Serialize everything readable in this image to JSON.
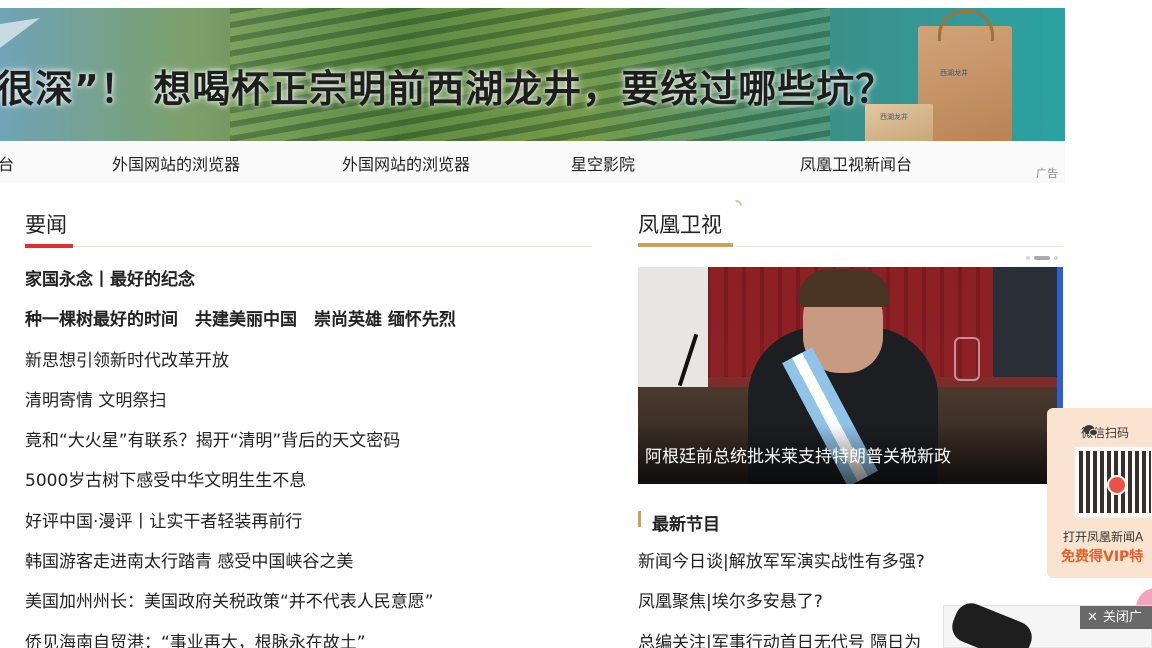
{
  "banner": {
    "headline": "很深”！ 想喝杯正宗明前西湖龙井，要绕过哪些坑？",
    "bag_text": "西湖龙井",
    "box_text": "西湖龙井"
  },
  "nav": {
    "items": [
      "台",
      "外国网站的浏览器",
      "外国网站的浏览器",
      "星空影院",
      "凤凰卫视新闻台"
    ],
    "ad_label": "广告"
  },
  "news": {
    "title": "要闻",
    "items": [
      "家国永念丨最好的纪念",
      "种一棵树最好的时间　共建美丽中国　崇尚英雄 缅怀先烈",
      "新思想引领新时代改革开放",
      "清明寄情 文明祭扫",
      "竟和“大火星”有联系？揭开“清明”背后的天文密码",
      "5000岁古树下感受中华文明生生不息",
      "好评中国·漫评丨让实干者轻装再前行",
      "韩国游客走进南太行踏青 感受中国峡谷之美",
      "美国加州州长：美国政府关税政策“并不代表人民意愿”",
      "侨见海南自贸港：“事业再大，根脉永在故土”"
    ]
  },
  "phoenix": {
    "title": "凤凰卫视",
    "video_caption": "阿根廷前总统批米莱支持特朗普关税新政",
    "latest_title": "最新节目",
    "programs": [
      "新闻今日谈|解放军军演实战性有多强?",
      "凤凰聚焦|埃尔多安悬了?",
      "总编关注|军事行动首日无代号 隔日为"
    ]
  },
  "qr_ad": {
    "head": "微信扫码",
    "line1": "打开凤凰新闻A",
    "line2": "免费得VIP特"
  },
  "video_ad": {
    "close_label": "关闭广"
  },
  "colors": {
    "news_accent": "#e0312c",
    "phoenix_accent": "#c8a35b",
    "qr_highlight": "#e0612a"
  }
}
